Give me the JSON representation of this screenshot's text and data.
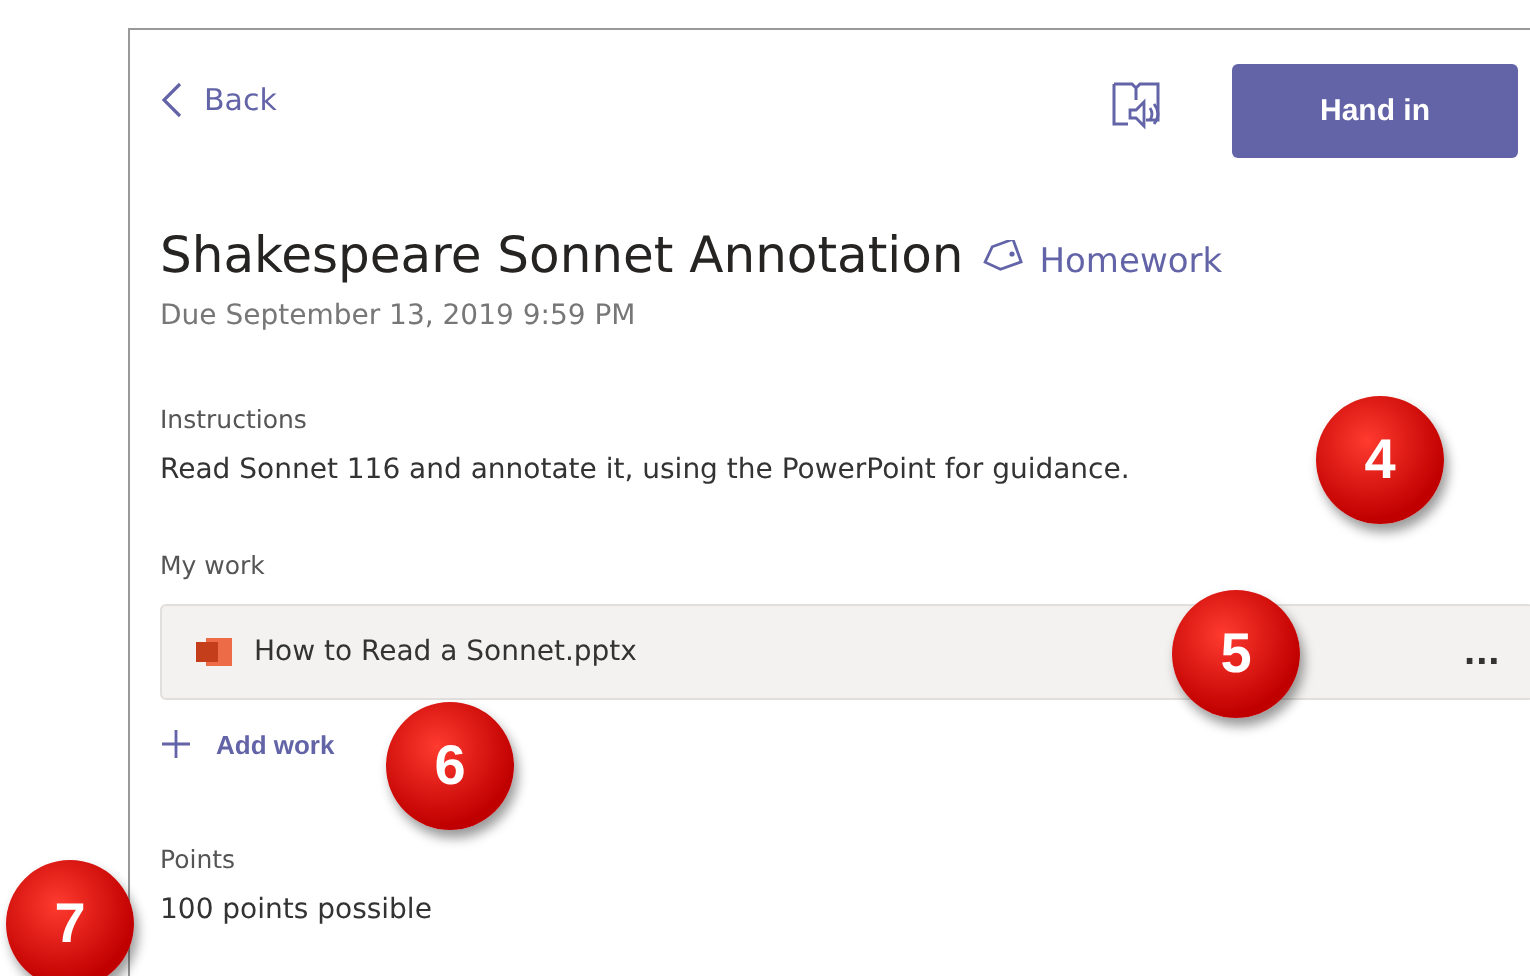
{
  "back": {
    "label": "Back"
  },
  "hand_in_button": {
    "label": "Hand in"
  },
  "title": "Shakespeare Sonnet Annotation",
  "category": "Homework",
  "due": "Due September 13, 2019 9:59 PM",
  "instructions": {
    "label": "Instructions",
    "text": "Read Sonnet 116 and annotate it, using the PowerPoint for guidance."
  },
  "my_work": {
    "label": "My work",
    "files": [
      {
        "name": "How to Read a Sonnet.pptx",
        "menu": "..."
      }
    ],
    "add_label": "Add work"
  },
  "points": {
    "label": "Points",
    "text": "100 points possible"
  },
  "callouts": [
    {
      "label": "4"
    },
    {
      "label": "5"
    },
    {
      "label": "6"
    },
    {
      "label": "7"
    }
  ]
}
